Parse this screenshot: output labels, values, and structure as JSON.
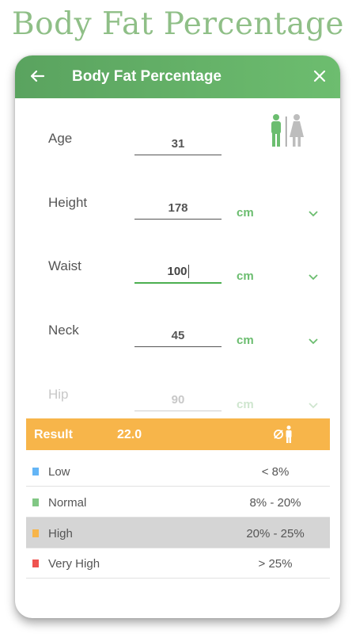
{
  "promo": {
    "title": "Body Fat Percentage"
  },
  "header": {
    "title": "Body Fat Percentage"
  },
  "form": {
    "age": {
      "label": "Age",
      "value": "31"
    },
    "height": {
      "label": "Height",
      "value": "178",
      "unit": "cm"
    },
    "waist": {
      "label": "Waist",
      "value": "100",
      "unit": "cm"
    },
    "neck": {
      "label": "Neck",
      "value": "45",
      "unit": "cm"
    },
    "hip": {
      "label": "Hip",
      "value": "90",
      "unit": "cm"
    }
  },
  "result": {
    "label": "Result",
    "value": "22.0"
  },
  "legend": [
    {
      "name": "Low",
      "range": "< 8%",
      "color": "#64b5f6"
    },
    {
      "name": "Normal",
      "range": "8% - 20%",
      "color": "#81c784"
    },
    {
      "name": "High",
      "range": "20% - 25%",
      "color": "#f7b54a"
    },
    {
      "name": "Very High",
      "range": "> 25%",
      "color": "#ef5350"
    }
  ],
  "colors": {
    "accent": "#5aa35f",
    "result": "#f7b54a",
    "selected": "#d5d5d5"
  },
  "icons": [
    "back-arrow-icon",
    "close-icon",
    "male-icon",
    "female-icon",
    "chevron-down-icon",
    "no-person-icon"
  ]
}
